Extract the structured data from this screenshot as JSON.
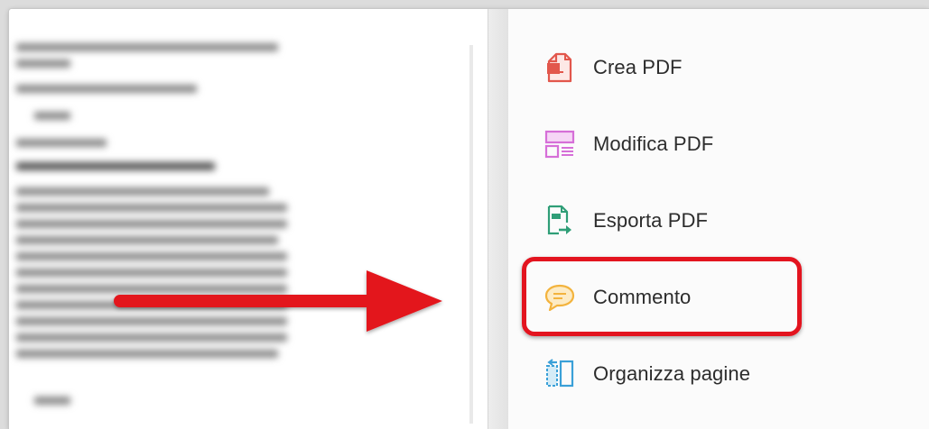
{
  "tools_panel": {
    "items": [
      {
        "label": "Crea PDF",
        "icon": "create-pdf-icon",
        "color": "#e2574c"
      },
      {
        "label": "Modifica PDF",
        "icon": "edit-pdf-icon",
        "color": "#d66fd8"
      },
      {
        "label": "Esporta PDF",
        "icon": "export-pdf-icon",
        "color": "#2f9e77"
      },
      {
        "label": "Commento",
        "icon": "comment-icon",
        "color": "#f3b33d"
      },
      {
        "label": "Organizza pagine",
        "icon": "organize-pages-icon",
        "color": "#3aa0d8"
      }
    ]
  },
  "annotation": {
    "arrow_color": "#e3141f",
    "highlight_color": "#e3141f",
    "highlighted_item": "Commento"
  }
}
